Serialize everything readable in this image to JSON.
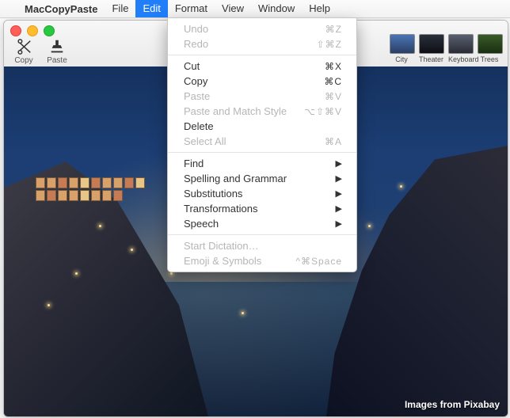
{
  "menubar": {
    "app_name": "MacCopyPaste",
    "items": [
      "File",
      "Edit",
      "Format",
      "View",
      "Window",
      "Help"
    ],
    "selected": 1
  },
  "toolbar": {
    "copy_label": "Copy",
    "paste_label": "Paste",
    "thumbs": [
      "City",
      "Theater",
      "Keyboard",
      "Trees"
    ]
  },
  "content": {
    "credit": "Images from Pixabay"
  },
  "menu": {
    "items": [
      {
        "label": "Undo",
        "shortcut": "⌘Z",
        "enabled": false
      },
      {
        "label": "Redo",
        "shortcut": "⇧⌘Z",
        "enabled": false
      },
      {
        "sep": true
      },
      {
        "label": "Cut",
        "shortcut": "⌘X",
        "enabled": true
      },
      {
        "label": "Copy",
        "shortcut": "⌘C",
        "enabled": true
      },
      {
        "label": "Paste",
        "shortcut": "⌘V",
        "enabled": false
      },
      {
        "label": "Paste and Match Style",
        "shortcut": "⌥⇧⌘V",
        "enabled": false
      },
      {
        "label": "Delete",
        "shortcut": "",
        "enabled": true
      },
      {
        "label": "Select All",
        "shortcut": "⌘A",
        "enabled": false
      },
      {
        "sep": true
      },
      {
        "label": "Find",
        "submenu": true,
        "enabled": true
      },
      {
        "label": "Spelling and Grammar",
        "submenu": true,
        "enabled": true
      },
      {
        "label": "Substitutions",
        "submenu": true,
        "enabled": true
      },
      {
        "label": "Transformations",
        "submenu": true,
        "enabled": true
      },
      {
        "label": "Speech",
        "submenu": true,
        "enabled": true
      },
      {
        "sep": true
      },
      {
        "label": "Start Dictation…",
        "shortcut": "",
        "enabled": false
      },
      {
        "label": "Emoji & Symbols",
        "shortcut": "^⌘Space",
        "enabled": false
      }
    ]
  }
}
